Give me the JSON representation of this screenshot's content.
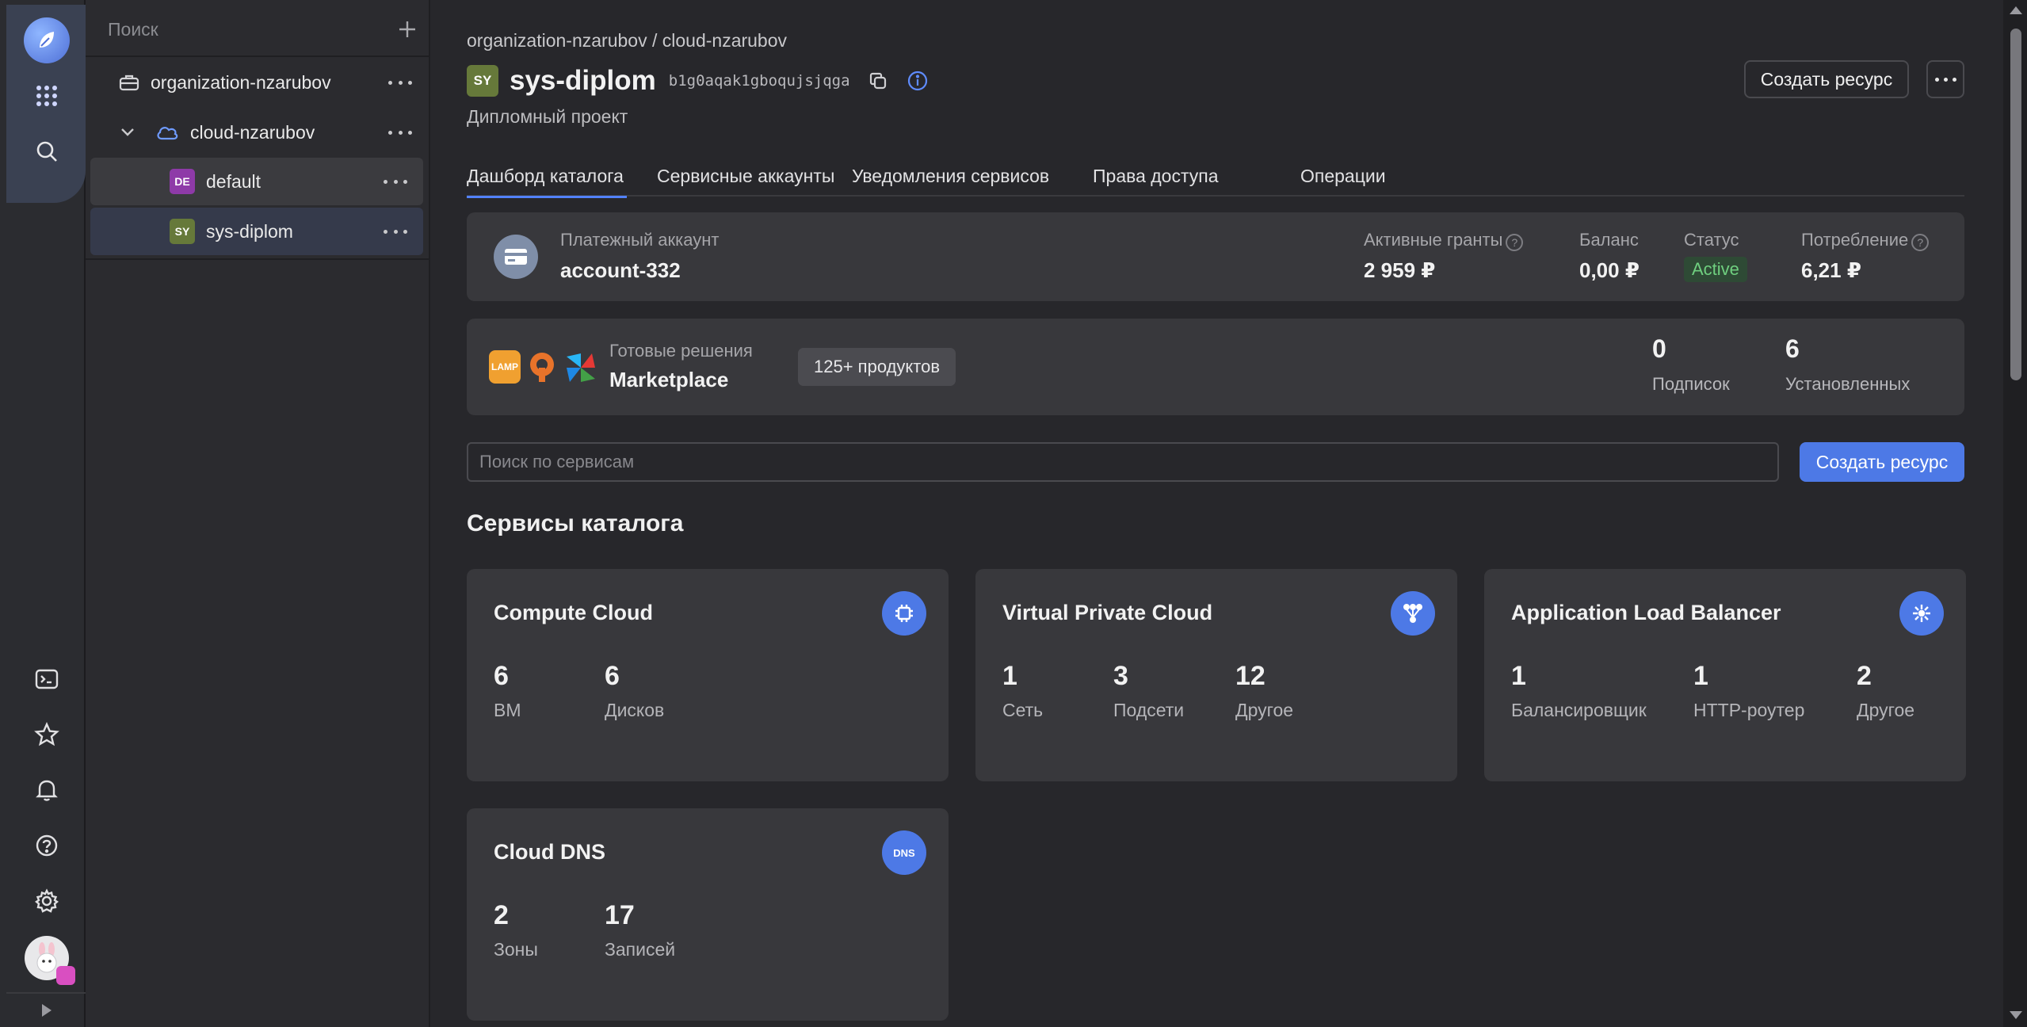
{
  "nav": {
    "search_placeholder": "Поиск",
    "tree": [
      {
        "label": "organization-nzarubov"
      },
      {
        "label": "cloud-nzarubov"
      },
      {
        "label": "default",
        "badge": "DE",
        "badge_color": "#8e3aa8"
      },
      {
        "label": "sys-diplom",
        "badge": "SY",
        "badge_color": "#66793a"
      }
    ]
  },
  "header": {
    "breadcrumb": "organization-nzarubov / cloud-nzarubov",
    "badge": "SY",
    "title": "sys-diplom",
    "id": "b1g0aqak1gboqujsjqga",
    "subtitle": "Дипломный проект",
    "create_button": "Создать ресурс"
  },
  "tabs": [
    {
      "label": "Дашборд каталога"
    },
    {
      "label": "Сервисные аккаунты"
    },
    {
      "label": "Уведомления сервисов"
    },
    {
      "label": "Права доступа"
    },
    {
      "label": "Операции"
    }
  ],
  "billing": {
    "account_label": "Платежный аккаунт",
    "account_value": "account-332",
    "grants_label": "Активные гранты",
    "grants_value": "2 959 ₽",
    "balance_label": "Баланс",
    "balance_value": "0,00 ₽",
    "status_label": "Статус",
    "status_value": "Active",
    "usage_label": "Потребление",
    "usage_value": "6,21 ₽"
  },
  "marketplace": {
    "label": "Готовые решения",
    "title": "Marketplace",
    "products_badge": "125+ продуктов",
    "subscriptions_value": "0",
    "subscriptions_label": "Подписок",
    "installed_value": "6",
    "installed_label": "Установленных",
    "logo_lamp": "LAMP"
  },
  "search": {
    "placeholder": "Поиск по сервисам",
    "create_button": "Создать ресурс"
  },
  "services_title": "Сервисы каталога",
  "services": [
    {
      "title": "Compute Cloud",
      "icon": "compute-icon",
      "stats": [
        {
          "n": "6",
          "l": "ВМ"
        },
        {
          "n": "6",
          "l": "Дисков"
        }
      ]
    },
    {
      "title": "Virtual Private Cloud",
      "icon": "network-icon",
      "stats": [
        {
          "n": "1",
          "l": "Сеть"
        },
        {
          "n": "3",
          "l": "Подсети"
        },
        {
          "n": "12",
          "l": "Другое"
        }
      ]
    },
    {
      "title": "Application Load Balancer",
      "icon": "balancer-icon",
      "stats": [
        {
          "n": "1",
          "l": "Балансировщик"
        },
        {
          "n": "1",
          "l": "HTTP-роутер"
        },
        {
          "n": "2",
          "l": "Другое"
        }
      ]
    },
    {
      "title": "Cloud DNS",
      "icon": "dns-icon",
      "icon_text": "DNS",
      "stats": [
        {
          "n": "2",
          "l": "Зоны"
        },
        {
          "n": "17",
          "l": "Записей"
        }
      ]
    }
  ],
  "colors": {
    "accent": "#4d79e6",
    "active_tab": "#5282ff",
    "status_active": "#6fcf7f"
  }
}
